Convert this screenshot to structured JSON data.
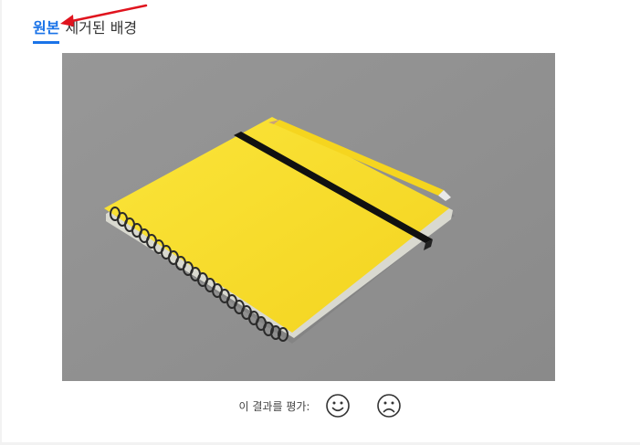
{
  "tabs": [
    {
      "label": "원본",
      "active": true
    },
    {
      "label": "제거된 배경",
      "active": false
    }
  ],
  "image": {
    "alt": "",
    "colors": {
      "background": "#919191",
      "notebook": "#f7dc2e",
      "strap": "#111111",
      "pencil": "#f5d51f"
    }
  },
  "rating": {
    "label": "이 결과를 평가:",
    "positive_icon": "smile-icon",
    "negative_icon": "frown-icon"
  },
  "annotation": {
    "arrow_color": "#e0141e"
  }
}
